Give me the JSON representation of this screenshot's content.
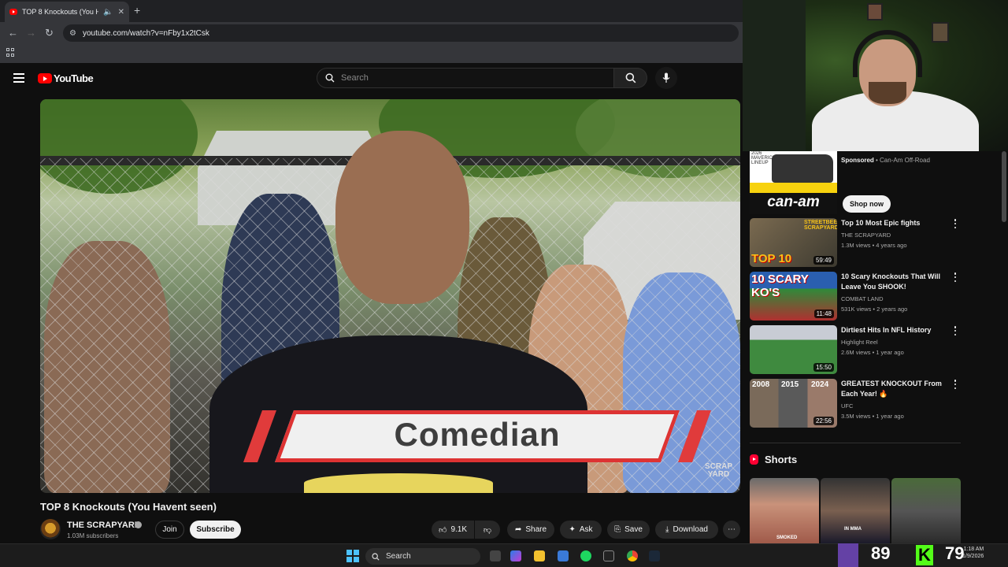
{
  "browser": {
    "tab_title": "TOP 8 Knockouts (You Haven",
    "tab_close": "✕",
    "new_tab": "+",
    "url": "youtube.com/watch?v=nFby1x2tCsk"
  },
  "youtube": {
    "logo_text": "YouTube",
    "search_placeholder": "Search"
  },
  "video": {
    "caption": "Comedian",
    "watermark": "SCRAP\nYARD",
    "title": "TOP 8 Knockouts (You Havent seen)",
    "channel_name": "THE SCRAPYARD",
    "subscribers": "1.03M subscribers",
    "join_label": "Join",
    "subscribe_label": "Subscribe",
    "likes": "9.1K",
    "share_label": "Share",
    "ask_label": "Ask",
    "save_label": "Save",
    "download_label": "Download"
  },
  "ad": {
    "tag": "2026 MAVERICK LINEUP",
    "brand": "can-am",
    "sponsored": "Sponsored",
    "advertiser": " • Can-Am Off-Road",
    "cta": "Shop now"
  },
  "recommendations": [
    {
      "title": "Top 10 Most Epic fights",
      "channel": "THE SCRAPYARD",
      "meta": "1.3M views • 4 years ago",
      "duration": "59:49",
      "thumb_text": "TOP 10",
      "thumb_sub": "STREETBEEFS SCRAPYARD"
    },
    {
      "title": "10 Scary Knockouts That Will Leave You SHOOK!",
      "channel": "COMBAT LAND",
      "meta": "531K views • 2 years ago",
      "duration": "11:48",
      "thumb_text": "10 SCARY KO'S"
    },
    {
      "title": "Dirtiest Hits In NFL History",
      "channel": "Highlight Reel",
      "meta": "2.6M views • 1 year ago",
      "duration": "15:50"
    },
    {
      "title": "GREATEST KNOCKOUT From Each Year! 🔥",
      "channel": "UFC",
      "meta": "3.5M views • 1 year ago",
      "duration": "22:56",
      "years": [
        "2008",
        "2015",
        "2024"
      ]
    }
  ],
  "shorts": {
    "title": "Shorts",
    "items": [
      {
        "label": "SMOKED"
      },
      {
        "label": "IN MMA"
      },
      {
        "label": ""
      }
    ]
  },
  "taskbar": {
    "search_label": "Search",
    "twitch_count": "89",
    "kick_letter": "K",
    "kick_count": "79",
    "time": "1:18 AM",
    "date": "1/9/2026"
  }
}
